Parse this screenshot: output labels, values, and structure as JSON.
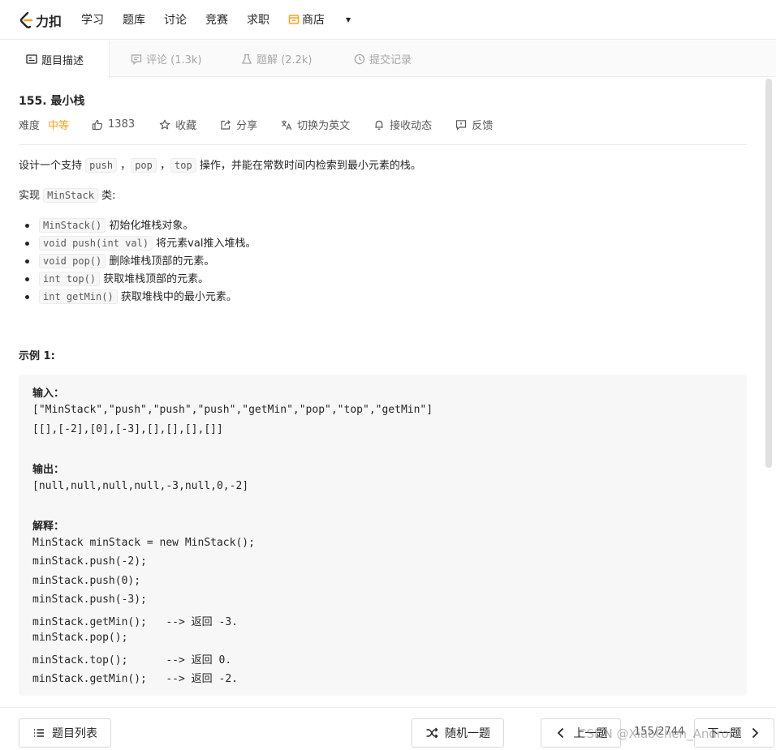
{
  "nav": {
    "logo_text": "力扣",
    "links": [
      "学习",
      "题库",
      "讨论",
      "竞赛",
      "求职"
    ],
    "store": "商店"
  },
  "tabs": {
    "description": "题目描述",
    "comments": "评论 (1.3k)",
    "solutions": "题解 (2.2k)",
    "submissions": "提交记录"
  },
  "problem": {
    "title": "155. 最小栈",
    "difficulty_label": "难度",
    "difficulty": "中等",
    "likes": "1383",
    "favorite": "收藏",
    "share": "分享",
    "switch_lang": "切换为英文",
    "subscribe": "接收动态",
    "feedback": "反馈"
  },
  "desc": {
    "line1_a": "设计一个支持 ",
    "code_push": "push",
    "sep1": " ，",
    "code_pop": "pop",
    "sep2": " ，",
    "code_top": "top",
    "line1_b": " 操作，并能在常数时间内检索到最小元素的栈。",
    "line2_a": "实现 ",
    "code_minstack": "MinStack",
    "line2_b": " 类:",
    "methods": [
      {
        "code": "MinStack()",
        "text": " 初始化堆栈对象。"
      },
      {
        "code": "void push(int val)",
        "text": " 将元素val推入堆栈。"
      },
      {
        "code": "void pop()",
        "text": " 删除堆栈顶部的元素。"
      },
      {
        "code": "int top()",
        "text": " 获取堆栈顶部的元素。"
      },
      {
        "code": "int getMin()",
        "text": " 获取堆栈中的最小元素。"
      }
    ]
  },
  "example": {
    "title": "示例 1:",
    "input_label": "输入：",
    "input_line1": "[\"MinStack\",\"push\",\"push\",\"push\",\"getMin\",\"pop\",\"top\",\"getMin\"]",
    "input_line2": "[[],[-2],[0],[-3],[],[],[],[]]",
    "output_label": "输出：",
    "output_line": "[null,null,null,null,-3,null,0,-2]",
    "explain_label": "解释：",
    "explain_lines": [
      "MinStack minStack = new MinStack();",
      "minStack.push(-2);",
      "minStack.push(0);",
      "minStack.push(-3);",
      "minStack.getMin();   --> 返回 -3.",
      "minStack.pop();",
      "minStack.top();      --> 返回 0.",
      "minStack.getMin();   --> 返回 -2."
    ]
  },
  "bottom": {
    "list_button": "题目列表",
    "random_button": "随机一题",
    "prev_button": "上一题",
    "page": "155/2744",
    "next_button": "下一题"
  },
  "watermark": "CSDN @XiaoChen_Android"
}
